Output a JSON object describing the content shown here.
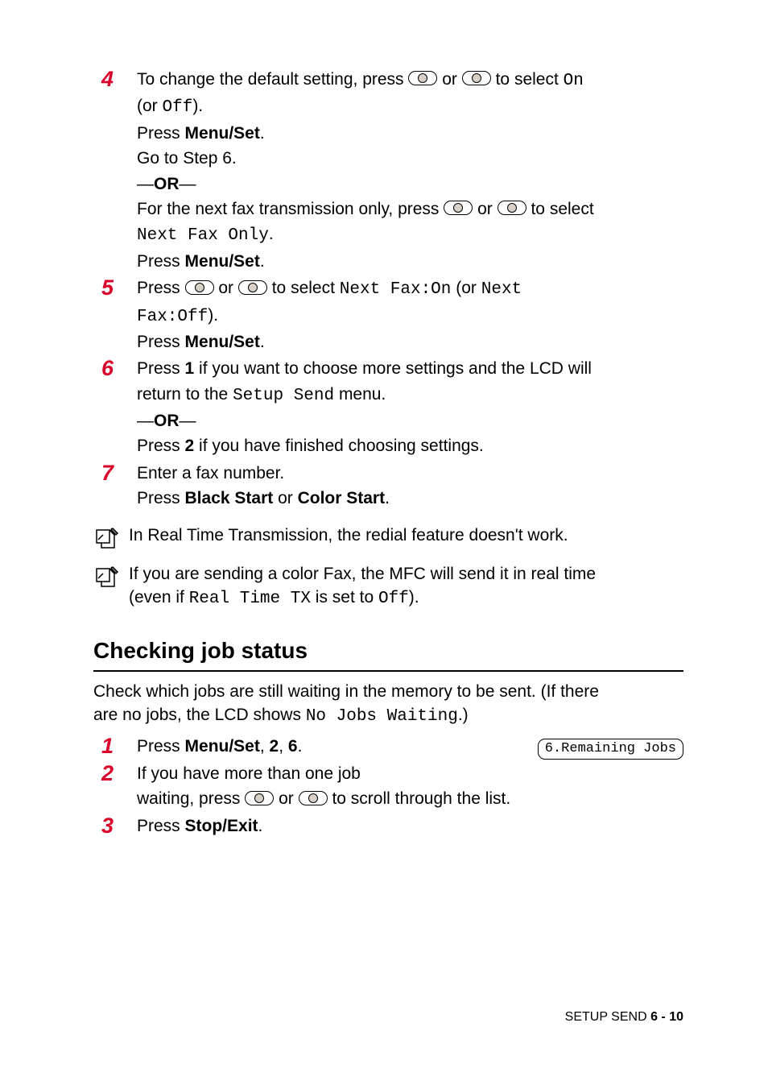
{
  "steps": {
    "s4": {
      "num": "4",
      "l1_a": "To change the default setting, press ",
      "l1_b": " or ",
      "l1_c": " to select ",
      "l1_on": "On",
      "l2_a": "(or ",
      "l2_off": "Off",
      "l2_b": ").",
      "l3_a": "Press ",
      "l3_b": "Menu/Set",
      "l3_c": ".",
      "l4": "Go to Step 6.",
      "or": "—OR—",
      "l5_a": "For the next fax transmission only, press ",
      "l5_b": " or ",
      "l5_c": " to select",
      "l6": "Next Fax Only",
      "l6_b": ".",
      "l7_a": "Press ",
      "l7_b": "Menu/Set",
      "l7_c": "."
    },
    "s5": {
      "num": "5",
      "l1_a": "Press ",
      "l1_b": " or ",
      "l1_c": " to select ",
      "l1_d": "Next Fax:On",
      "l1_e": " (or ",
      "l1_f": "Next",
      "l2_a": "Fax:Off",
      "l2_b": ").",
      "l3_a": "Press ",
      "l3_b": "Menu/Set",
      "l3_c": "."
    },
    "s6": {
      "num": "6",
      "l1_a": "Press ",
      "l1_b": "1",
      "l1_c": " if you want to choose more settings and the LCD will",
      "l2_a": "return to the ",
      "l2_b": "Setup Send",
      "l2_c": " menu.",
      "or": "—OR—",
      "l3_a": "Press ",
      "l3_b": "2",
      "l3_c": " if you have finished choosing settings."
    },
    "s7": {
      "num": "7",
      "l1": "Enter a fax number.",
      "l2_a": "Press ",
      "l2_b": "Black Start",
      "l2_c": " or ",
      "l2_d": "Color Start",
      "l2_e": "."
    }
  },
  "notes": {
    "n1": "In Real Time Transmission, the redial feature doesn't work.",
    "n2_a": "If you are sending a color Fax, the MFC will send it in real time",
    "n2_b": "(even if ",
    "n2_c": "Real Time TX",
    "n2_d": " is set to ",
    "n2_e": "Off",
    "n2_f": ")."
  },
  "section": {
    "heading": "Checking job status",
    "intro_a": "Check which jobs are still waiting in the memory to be sent. (If there",
    "intro_b": "are no jobs, the LCD shows ",
    "intro_c": "No Jobs Waiting",
    "intro_d": ".)",
    "lcd": "6.Remaining Jobs",
    "s1": {
      "num": "1",
      "a": "Press ",
      "b": "Menu/Set",
      "c": ", ",
      "d": "2",
      "e": ", ",
      "f": "6",
      "g": "."
    },
    "s2": {
      "num": "2",
      "a": "If you have more than one job",
      "b_a": "waiting, press ",
      "b_b": " or ",
      "b_c": " to scroll through the list."
    },
    "s3": {
      "num": "3",
      "a": "Press ",
      "b": "Stop/Exit",
      "c": "."
    }
  },
  "footer": {
    "label": "SETUP SEND   ",
    "page": "6 - 10"
  }
}
